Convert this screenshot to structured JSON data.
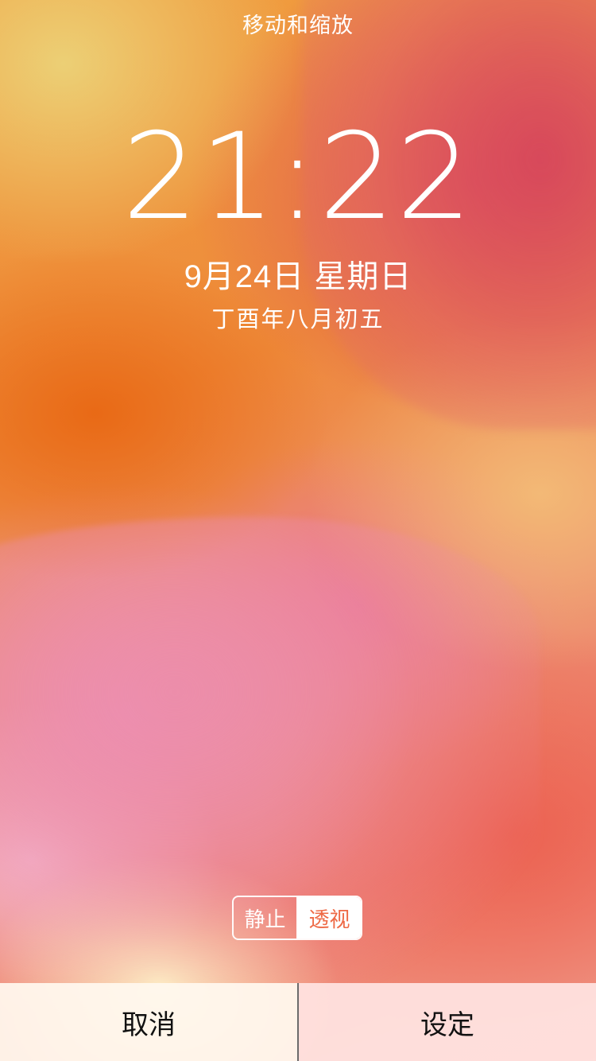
{
  "header": {
    "title": "移动和缩放"
  },
  "lockscreen": {
    "time": "21:22",
    "date": "9月24日 星期日",
    "lunar_date": "丁酉年八月初五"
  },
  "perspective_toggle": {
    "options": [
      {
        "label": "静止",
        "selected": false
      },
      {
        "label": "透视",
        "selected": true
      }
    ]
  },
  "actions": {
    "cancel_label": "取消",
    "set_label": "设定"
  },
  "colors": {
    "toggle_selected_text": "#ee6a46",
    "text_primary": "#ffffff",
    "action_text": "#111111"
  }
}
